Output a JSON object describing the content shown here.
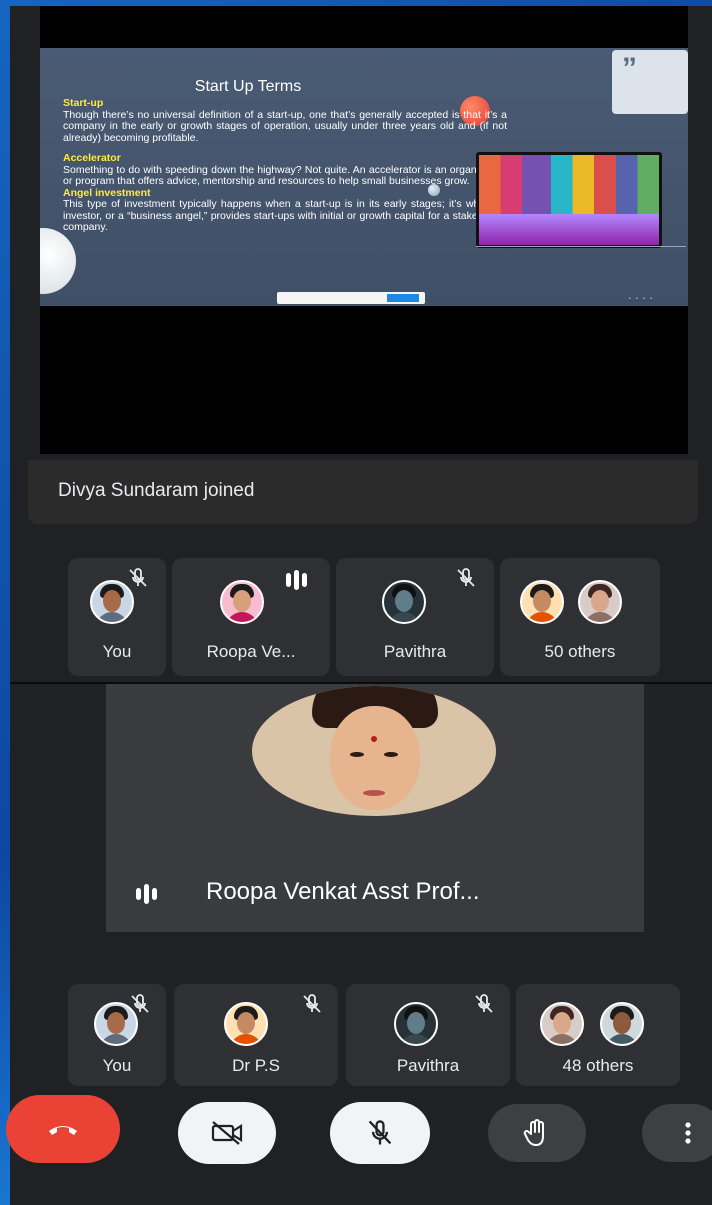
{
  "slide": {
    "quote_mark": "”",
    "title": "Start Up Terms",
    "sections": [
      {
        "heading": "Start-up",
        "text": "Though there’s no universal definition of a start-up, one that’s generally accepted is that it’s a company in the early or growth stages of operation, usually under three years old and (if not already) becoming profitable."
      },
      {
        "heading": "Accelerator",
        "text": "Something to do with speeding down the highway? Not quite. An accelerator is an organization or program that offers advice, mentorship and resources to help small businesses grow."
      },
      {
        "heading": "Angel investment",
        "text": "This type of investment typically happens when a start-up is in its early stages; it’s when an investor, or a “business angel,” provides start-ups with initial or growth capital for a stake in the company."
      }
    ]
  },
  "notification": {
    "text": "Divya Sundaram joined"
  },
  "top_participants": [
    {
      "name": "You",
      "status": "muted"
    },
    {
      "name": "Roopa Ve...",
      "status": "speaking"
    },
    {
      "name": "Pavithra",
      "status": "muted"
    },
    {
      "name": "50 others",
      "status": "group"
    }
  ],
  "active_speaker": {
    "name": "Roopa Venkat Asst Prof..."
  },
  "bottom_participants": [
    {
      "name": "You",
      "status": "muted"
    },
    {
      "name": "Dr P.S",
      "status": "muted"
    },
    {
      "name": "Pavithra",
      "status": "muted"
    },
    {
      "name": "48 others",
      "status": "group"
    }
  ],
  "controls": {
    "end_call": "phone-hangup-icon",
    "camera": "camera-off-icon",
    "mic": "mic-off-icon",
    "raise_hand": "hand-icon",
    "more": "more-vert-icon"
  },
  "colors": {
    "end_call_red": "#ea4335",
    "slide_heading_yellow": "#ffeb3b",
    "surface": "#202124",
    "tile": "#2f3033"
  }
}
